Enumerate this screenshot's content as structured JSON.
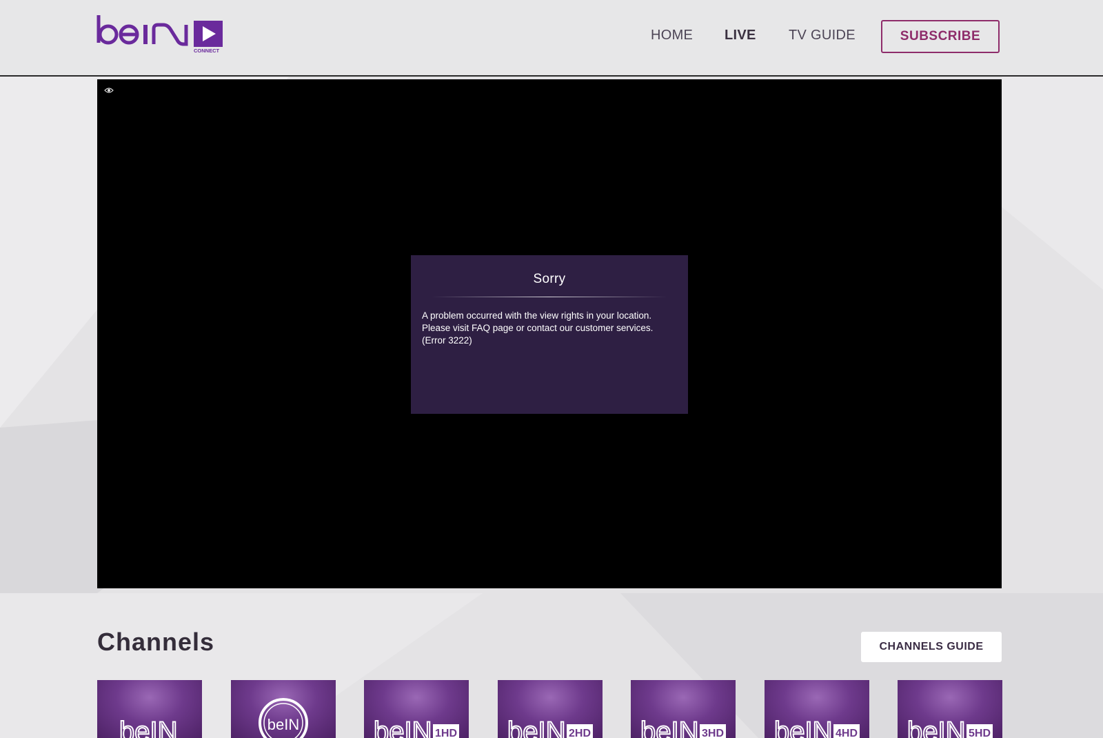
{
  "header": {
    "logo_alt": "beIN CONNECT",
    "nav": {
      "home": "HOME",
      "live": "LIVE",
      "tv_guide": "TV GUIDE"
    },
    "subscribe_label": "SUBSCRIBE"
  },
  "player": {
    "error": {
      "title": "Sorry",
      "lines": [
        "A problem occurred with the view rights in your location.",
        "Please visit FAQ page or contact our customer services.",
        "(Error 3222)"
      ]
    }
  },
  "channels": {
    "title": "Channels",
    "guide_label": "CHANNELS GUIDE",
    "tiles": [
      {
        "name": "beIN",
        "suffix": ""
      },
      {
        "name": "beIN SPORTS",
        "suffix": ""
      },
      {
        "name": "beIN",
        "suffix": "1HD"
      },
      {
        "name": "beIN",
        "suffix": "2HD"
      },
      {
        "name": "beIN",
        "suffix": "3HD"
      },
      {
        "name": "beIN",
        "suffix": "4HD"
      },
      {
        "name": "beIN",
        "suffix": "5HD"
      }
    ]
  },
  "colors": {
    "brand_purple": "#6a2a9c",
    "subscribe_accent": "#8e2c6a",
    "error_box_bg": "#2e1f43"
  }
}
